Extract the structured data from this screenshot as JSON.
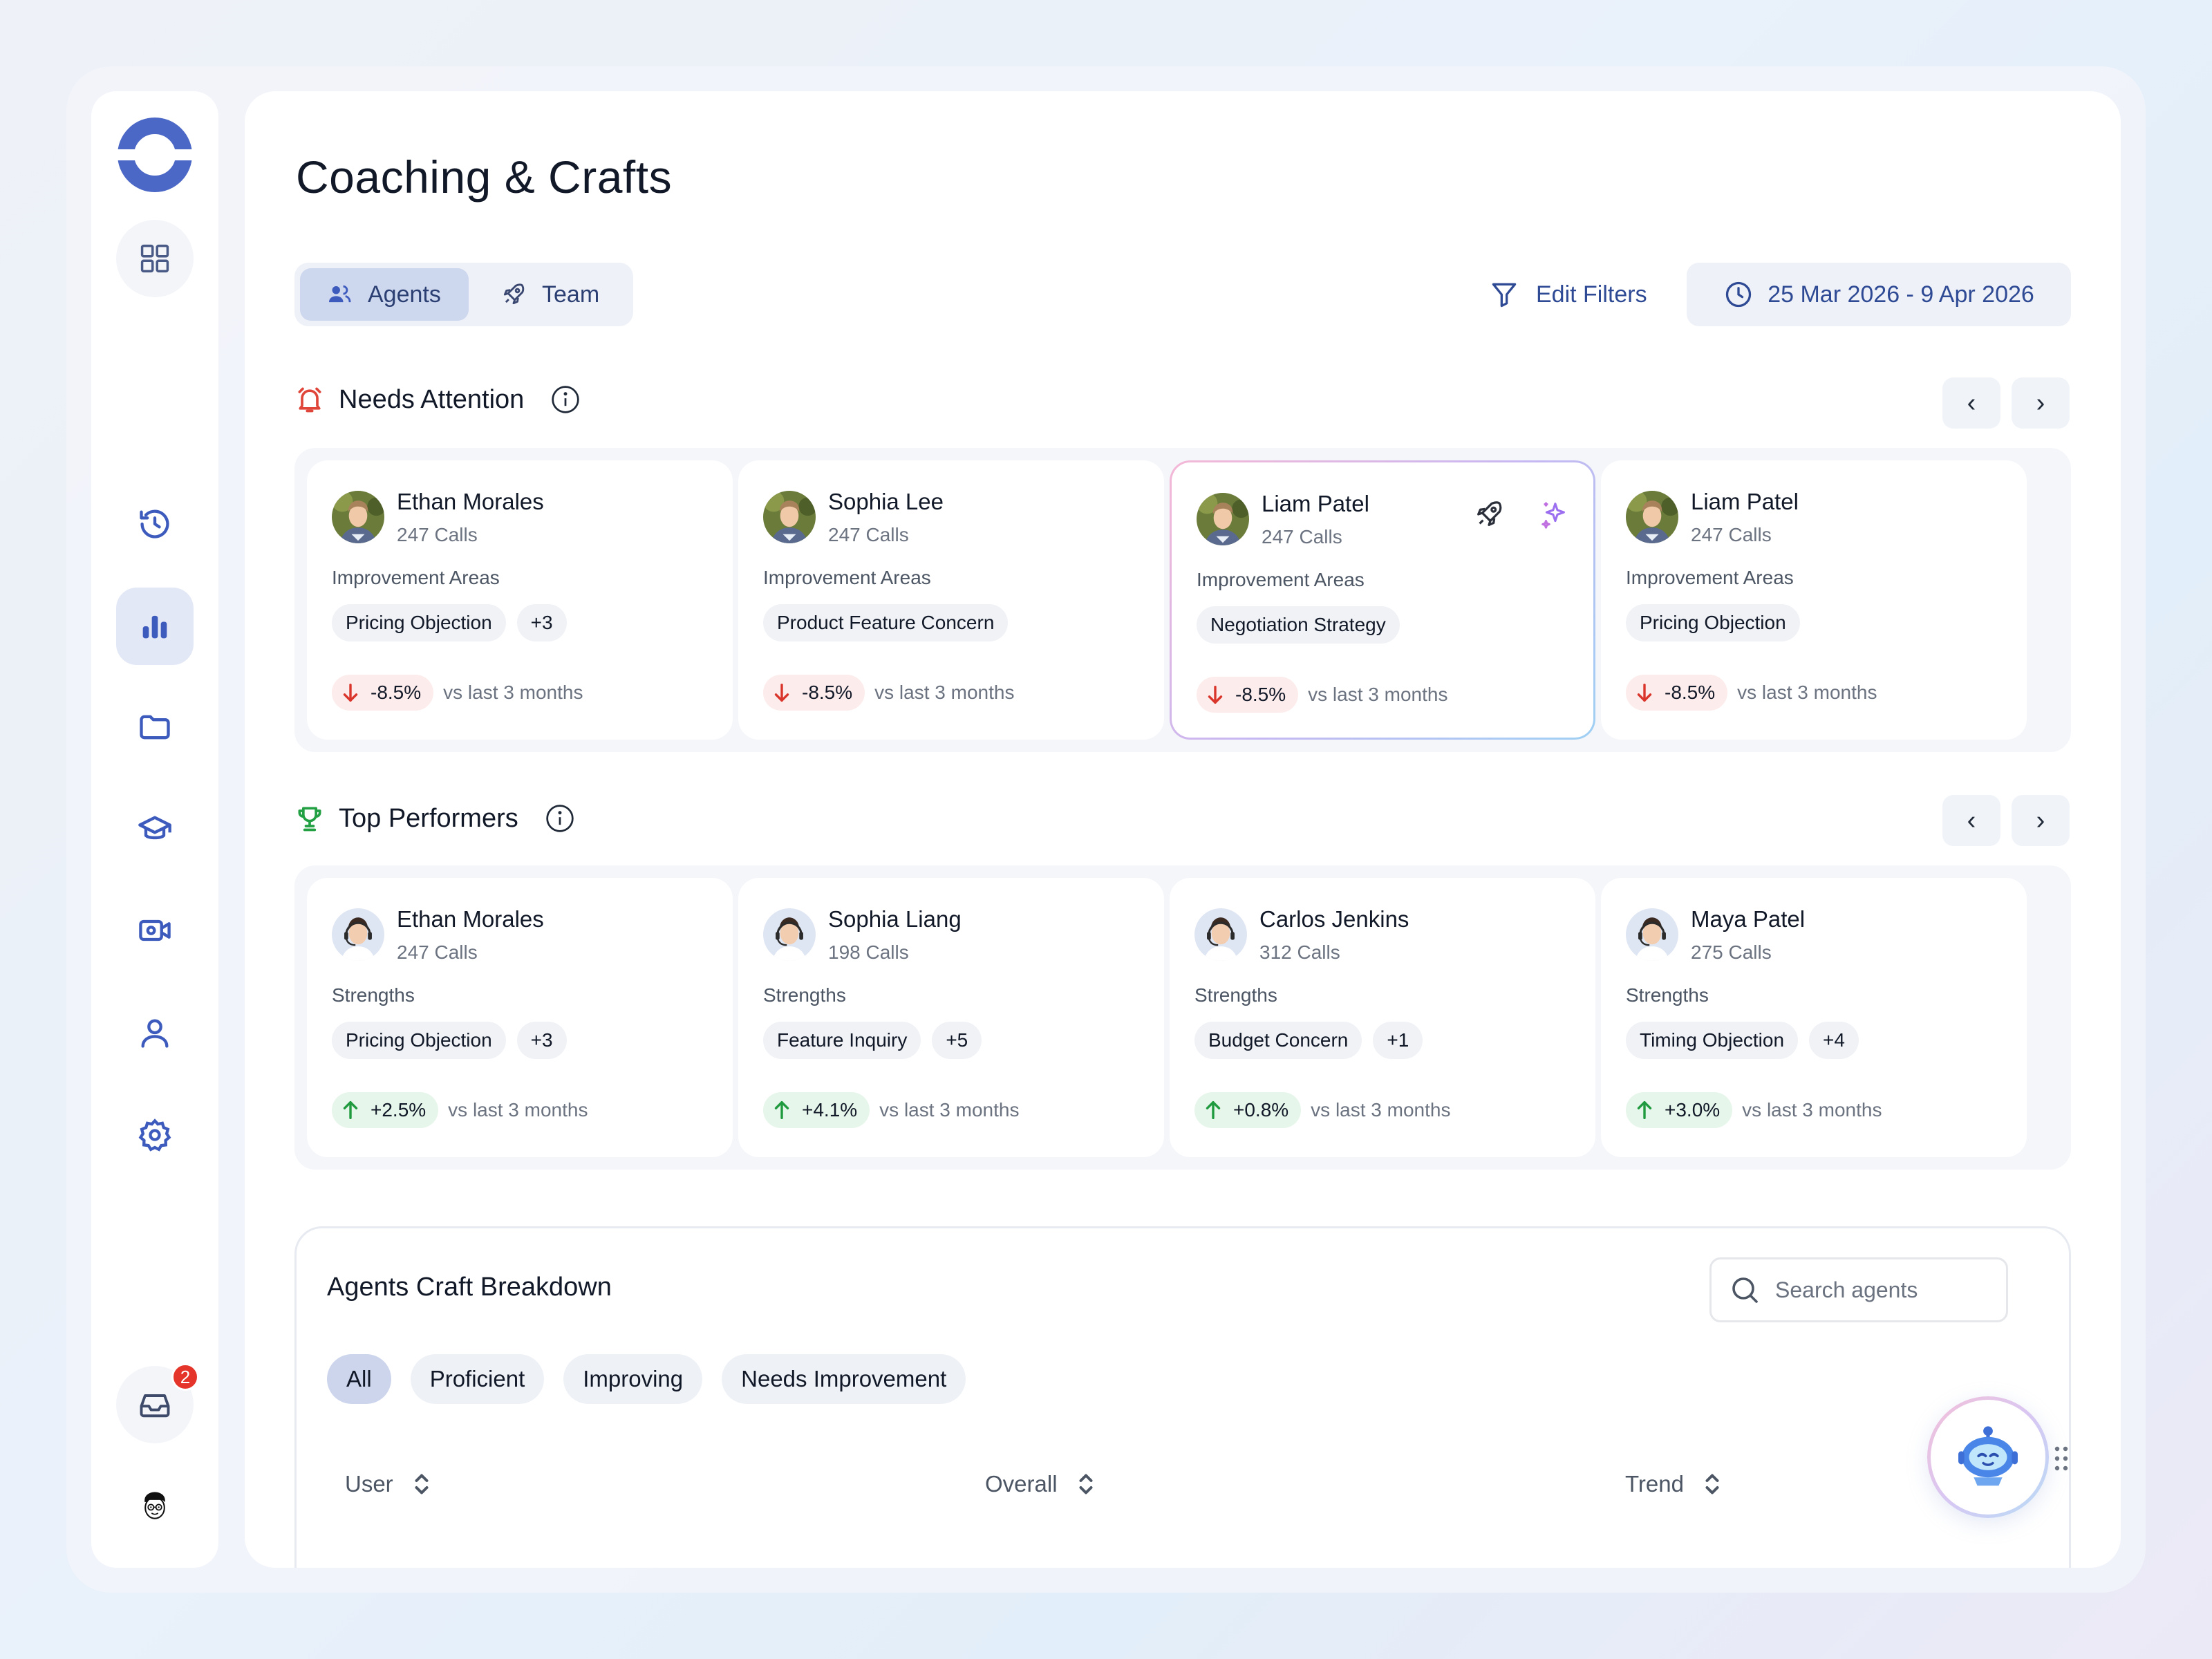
{
  "page": {
    "title": "Coaching & Crafts"
  },
  "sidebar": {
    "items": [
      {
        "icon": "grid-icon"
      },
      {
        "icon": "history-icon"
      },
      {
        "icon": "bar-chart-icon",
        "active": true
      },
      {
        "icon": "folder-icon"
      },
      {
        "icon": "graduation-cap-icon"
      },
      {
        "icon": "video-icon"
      },
      {
        "icon": "user-icon"
      },
      {
        "icon": "settings-icon"
      }
    ],
    "inbox": {
      "icon": "inbox-icon",
      "badge": "2"
    },
    "profile": {
      "icon": "profile-avatar-icon"
    }
  },
  "toggle": {
    "agents": "Agents",
    "team": "Team",
    "selected": "Agents"
  },
  "toolbar": {
    "edit_filters": "Edit Filters",
    "date_range": "25 Mar 2026 - 9 Apr 2026"
  },
  "needs_attention": {
    "title": "Needs Attention",
    "cards": [
      {
        "name": "Ethan Morales",
        "calls": "247 Calls",
        "label": "Improvement Areas",
        "tag": "Pricing Objection",
        "more": "+3",
        "delta": "-8.5%",
        "compare": "vs last 3 months"
      },
      {
        "name": "Sophia Lee",
        "calls": "247 Calls",
        "label": "Improvement Areas",
        "tag": "Product Feature Concern",
        "more": "",
        "delta": "-8.5%",
        "compare": "vs last 3 months"
      },
      {
        "name": "Liam Patel",
        "calls": "247 Calls",
        "label": "Improvement Areas",
        "tag": "Negotiation Strategy",
        "more": "",
        "delta": "-8.5%",
        "compare": "vs last 3 months"
      },
      {
        "name": "Liam Patel",
        "calls": "247 Calls",
        "label": "Improvement Areas",
        "tag": "Pricing Objection",
        "more": "",
        "delta": "-8.5%",
        "compare": "vs last 3 months"
      }
    ]
  },
  "top_performers": {
    "title": "Top Performers",
    "cards": [
      {
        "name": "Ethan Morales",
        "calls": "247 Calls",
        "label": "Strengths",
        "tag": "Pricing Objection",
        "more": "+3",
        "delta": "+2.5%",
        "compare": "vs last 3 months"
      },
      {
        "name": "Sophia Liang",
        "calls": "198 Calls",
        "label": "Strengths",
        "tag": "Feature Inquiry",
        "more": "+5",
        "delta": "+4.1%",
        "compare": "vs last 3 months"
      },
      {
        "name": "Carlos Jenkins",
        "calls": "312 Calls",
        "label": "Strengths",
        "tag": "Budget Concern",
        "more": "+1",
        "delta": "+0.8%",
        "compare": "vs last 3 months"
      },
      {
        "name": "Maya Patel",
        "calls": "275 Calls",
        "label": "Strengths",
        "tag": "Timing Objection",
        "more": "+4",
        "delta": "+3.0%",
        "compare": "vs last 3 months"
      }
    ]
  },
  "breakdown": {
    "title": "Agents Craft Breakdown",
    "search_placeholder": "Search agents",
    "filters": [
      "All",
      "Proficient",
      "Improving",
      "Needs Improvement"
    ],
    "selected_filter": "All",
    "columns": [
      "User",
      "Overall",
      "Trend"
    ]
  },
  "colors": {
    "accent": "#4a66c4",
    "active_bg": "#e3e8f6",
    "down": "#d9352b",
    "up": "#1f9a3e",
    "badge": "#e5342a"
  }
}
